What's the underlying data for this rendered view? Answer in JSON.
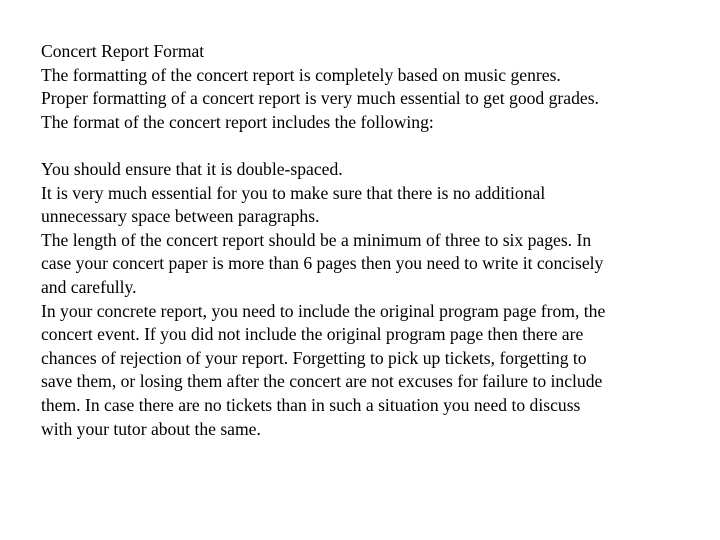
{
  "document": {
    "title": "Concert Report Format",
    "intro_lines": [
      "The formatting of the concert report is completely based on music genres.",
      "Proper formatting of a concert report is very much essential to get good grades.",
      "The format of the concert report includes the following:"
    ],
    "body_lines": [
      "You should ensure that it is double-spaced.",
      "It is very much essential for you to make sure that there is no additional",
      "unnecessary space between paragraphs.",
      "The length of the concert report should be a minimum of three to six pages. In",
      "case your concert paper is more than 6 pages then you need to write it concisely",
      "and carefully.",
      "In your concrete report, you need to include the original program page from, the",
      "concert event. If you did not include the original program page then there are",
      "chances of rejection of your report. Forgetting to pick up tickets, forgetting to",
      "save them, or losing them after the concert are not excuses for failure to include",
      "them. In case there are no tickets than in such a situation you need to discuss",
      "with your tutor about the same."
    ]
  }
}
